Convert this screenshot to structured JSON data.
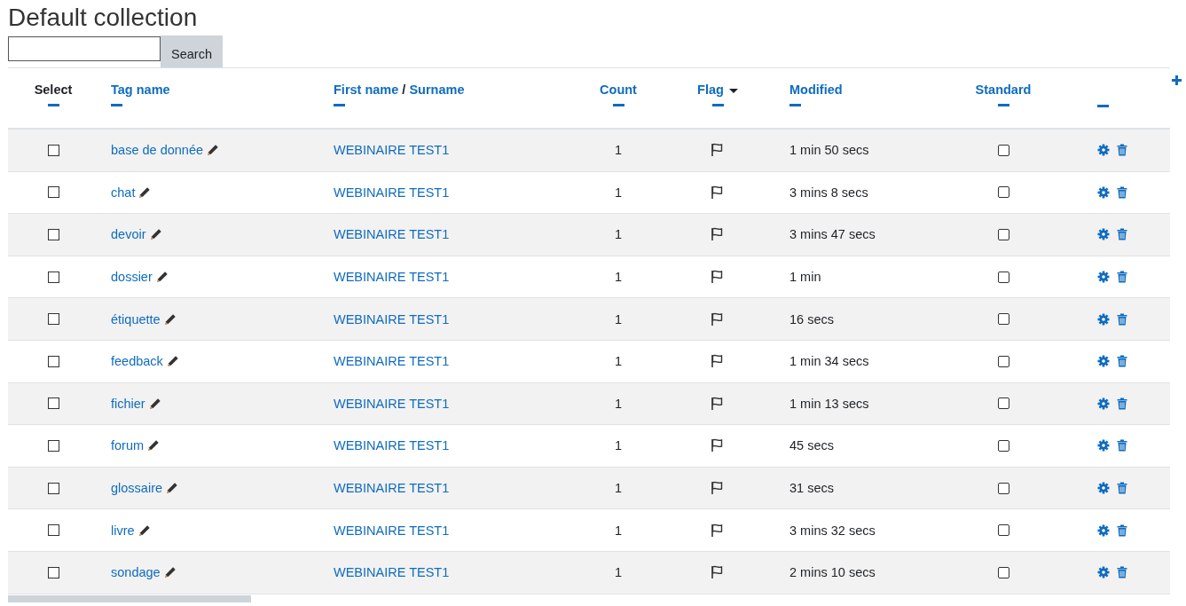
{
  "title": "Default collection",
  "search": {
    "button": "Search"
  },
  "columns": [
    {
      "kind": "plain",
      "label": "Select",
      "sorted": false
    },
    {
      "kind": "link",
      "label": "Tag name",
      "sorted": false
    },
    {
      "kind": "links",
      "labels": [
        "First name",
        "Surname"
      ],
      "separator": "/",
      "sorted": false
    },
    {
      "kind": "link",
      "label": "Count",
      "sorted": false
    },
    {
      "kind": "link",
      "label": "Flag",
      "sorted": true
    },
    {
      "kind": "link",
      "label": "Modified",
      "sorted": false
    },
    {
      "kind": "link",
      "label": "Standard",
      "sorted": false
    },
    {
      "kind": "blank",
      "sorted": false
    }
  ],
  "rows": [
    {
      "selected": false,
      "tag": "base de donnée",
      "owner": "WEBINAIRE TEST1",
      "count": "1",
      "flagged": false,
      "modified": "1 min 50 secs",
      "standard": false
    },
    {
      "selected": false,
      "tag": "chat",
      "owner": "WEBINAIRE TEST1",
      "count": "1",
      "flagged": false,
      "modified": "3 mins 8 secs",
      "standard": false
    },
    {
      "selected": false,
      "tag": "devoir",
      "owner": "WEBINAIRE TEST1",
      "count": "1",
      "flagged": false,
      "modified": "3 mins 47 secs",
      "standard": false
    },
    {
      "selected": false,
      "tag": "dossier",
      "owner": "WEBINAIRE TEST1",
      "count": "1",
      "flagged": false,
      "modified": "1 min",
      "standard": false
    },
    {
      "selected": false,
      "tag": "étiquette",
      "owner": "WEBINAIRE TEST1",
      "count": "1",
      "flagged": false,
      "modified": "16 secs",
      "standard": false
    },
    {
      "selected": false,
      "tag": "feedback",
      "owner": "WEBINAIRE TEST1",
      "count": "1",
      "flagged": false,
      "modified": "1 min 34 secs",
      "standard": false
    },
    {
      "selected": false,
      "tag": "fichier",
      "owner": "WEBINAIRE TEST1",
      "count": "1",
      "flagged": false,
      "modified": "1 min 13 secs",
      "standard": false
    },
    {
      "selected": false,
      "tag": "forum",
      "owner": "WEBINAIRE TEST1",
      "count": "1",
      "flagged": false,
      "modified": "45 secs",
      "standard": false
    },
    {
      "selected": false,
      "tag": "glossaire",
      "owner": "WEBINAIRE TEST1",
      "count": "1",
      "flagged": false,
      "modified": "31 secs",
      "standard": false
    },
    {
      "selected": false,
      "tag": "livre",
      "owner": "WEBINAIRE TEST1",
      "count": "1",
      "flagged": false,
      "modified": "3 mins 32 secs",
      "standard": false
    },
    {
      "selected": false,
      "tag": "sondage",
      "owner": "WEBINAIRE TEST1",
      "count": "1",
      "flagged": false,
      "modified": "2 mins 10 secs",
      "standard": false
    }
  ]
}
